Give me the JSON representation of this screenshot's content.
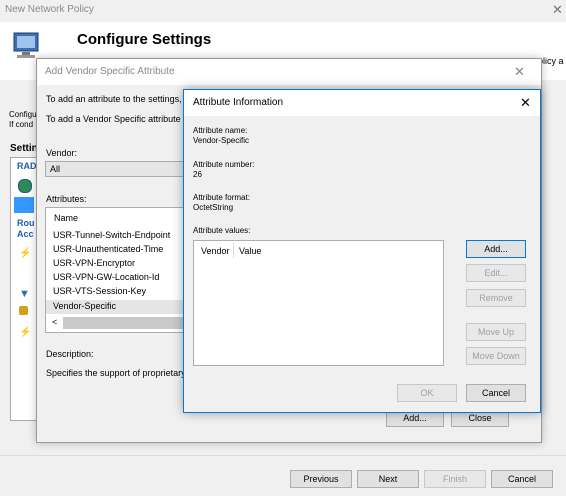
{
  "wizard": {
    "title": "New Network Policy",
    "heading": "Configure Settings",
    "heading_right": "policy a",
    "left_text1": "Configu",
    "left_text2": "If cond",
    "settings_label": "Settin",
    "left_rad": "RAD",
    "left_rou": "Rou",
    "left_acc": "Acc",
    "buttons": {
      "previous": "Previous",
      "next": "Next",
      "finish": "Finish",
      "cancel": "Cancel"
    }
  },
  "vsa_dialog": {
    "title": "Add Vendor Specific Attribute",
    "line1": "To add an attribute to the settings,",
    "line2": "To add a Vendor Specific attribute",
    "vendor_label": "Vendor:",
    "vendor_value": "All",
    "attributes_label": "Attributes:",
    "column_name": "Name",
    "items": [
      "USR-Tunnel-Switch-Endpoint",
      "USR-Unauthenticated-Time",
      "USR-VPN-Encryptor",
      "USR-VPN-GW-Location-Id",
      "USR-VTS-Session-Key",
      "Vendor-Specific"
    ],
    "scroll_left": "<",
    "description_label": "Description:",
    "description_text": "Specifies the support of proprietary",
    "buttons": {
      "add": "Add...",
      "close": "Close"
    }
  },
  "attr_dialog": {
    "title": "Attribute Information",
    "name_label": "Attribute name:",
    "name_value": "Vendor-Specific",
    "number_label": "Attribute number:",
    "number_value": "26",
    "format_label": "Attribute format:",
    "format_value": "OctetString",
    "values_label": "Attribute values:",
    "col_vendor": "Vendor",
    "col_value": "Value",
    "buttons": {
      "add": "Add...",
      "edit": "Edit...",
      "remove": "Remove",
      "move_up": "Move Up",
      "move_down": "Move Down",
      "ok": "OK",
      "cancel": "Cancel"
    }
  }
}
